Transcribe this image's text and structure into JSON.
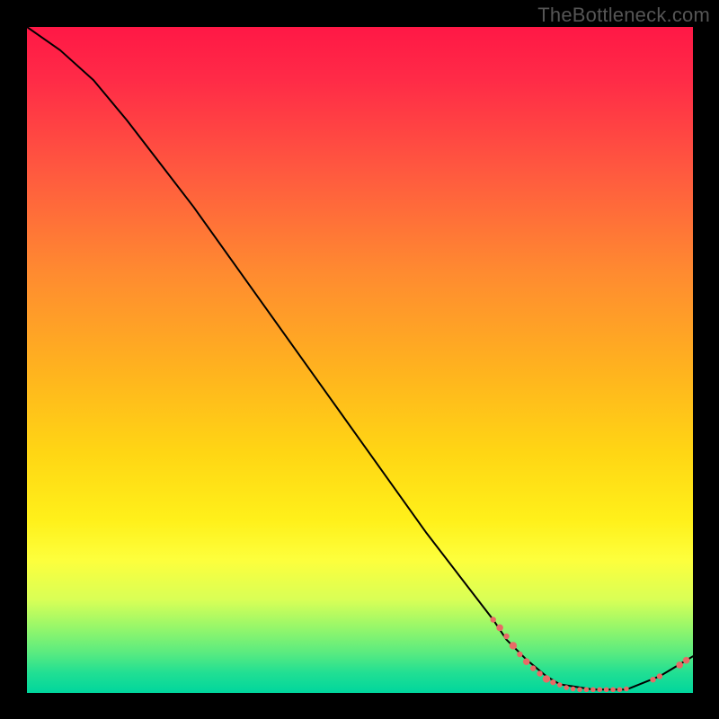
{
  "watermark": "TheBottleneck.com",
  "chart_data": {
    "type": "line",
    "title": "",
    "xlabel": "",
    "ylabel": "",
    "xlim": [
      0,
      100
    ],
    "ylim": [
      0,
      100
    ],
    "series": [
      {
        "name": "curve",
        "x": [
          0,
          5,
          10,
          15,
          20,
          25,
          30,
          35,
          40,
          45,
          50,
          55,
          60,
          65,
          70,
          72,
          75,
          78,
          80,
          85,
          90,
          95,
          100
        ],
        "y": [
          100,
          96.5,
          92,
          86,
          79.5,
          73,
          66,
          59,
          52,
          45,
          38,
          31,
          24,
          17.5,
          11,
          8,
          5,
          2.5,
          1.3,
          0.5,
          0.5,
          2.5,
          5.5
        ]
      }
    ],
    "scatter_points": {
      "name": "markers",
      "color": "#e86a66",
      "points": [
        {
          "x": 70,
          "y": 11,
          "r": 3.2
        },
        {
          "x": 71,
          "y": 9.8,
          "r": 3.8
        },
        {
          "x": 72,
          "y": 8.5,
          "r": 3.2
        },
        {
          "x": 73,
          "y": 7.1,
          "r": 4.2
        },
        {
          "x": 74,
          "y": 5.8,
          "r": 3.2
        },
        {
          "x": 75,
          "y": 4.7,
          "r": 3.8
        },
        {
          "x": 76,
          "y": 3.7,
          "r": 3.2
        },
        {
          "x": 77,
          "y": 2.9,
          "r": 3.2
        },
        {
          "x": 78,
          "y": 2.1,
          "r": 4.2
        },
        {
          "x": 79,
          "y": 1.6,
          "r": 3.2
        },
        {
          "x": 80,
          "y": 1.2,
          "r": 2.8
        },
        {
          "x": 81,
          "y": 0.8,
          "r": 2.8
        },
        {
          "x": 82,
          "y": 0.6,
          "r": 2.8
        },
        {
          "x": 83,
          "y": 0.5,
          "r": 2.8
        },
        {
          "x": 84,
          "y": 0.5,
          "r": 2.8
        },
        {
          "x": 85,
          "y": 0.5,
          "r": 2.8
        },
        {
          "x": 86,
          "y": 0.5,
          "r": 2.8
        },
        {
          "x": 87,
          "y": 0.5,
          "r": 2.8
        },
        {
          "x": 88,
          "y": 0.5,
          "r": 2.8
        },
        {
          "x": 89,
          "y": 0.5,
          "r": 2.8
        },
        {
          "x": 90,
          "y": 0.6,
          "r": 2.8
        },
        {
          "x": 94,
          "y": 2.0,
          "r": 3.2
        },
        {
          "x": 95,
          "y": 2.5,
          "r": 3.2
        },
        {
          "x": 98,
          "y": 4.2,
          "r": 3.8
        },
        {
          "x": 99,
          "y": 4.9,
          "r": 3.8
        }
      ]
    }
  }
}
